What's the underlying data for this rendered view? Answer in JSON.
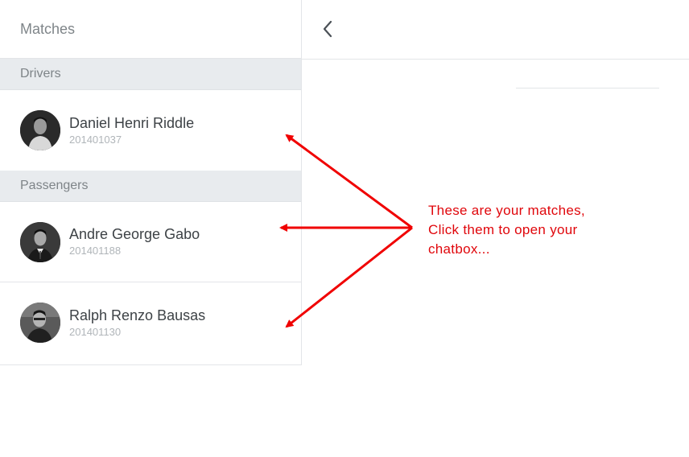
{
  "sidebar": {
    "title": "Matches",
    "sections": [
      {
        "label": "Drivers",
        "items": [
          {
            "name": "Daniel Henri Riddle",
            "id": "201401037"
          }
        ]
      },
      {
        "label": "Passengers",
        "items": [
          {
            "name": "Andre George Gabo",
            "id": "201401188"
          },
          {
            "name": "Ralph Renzo Bausas",
            "id": "201401130"
          }
        ]
      }
    ]
  },
  "chat": {
    "back_icon": "chevron-left-icon"
  },
  "annotation": {
    "line1": "These are your matches,",
    "line2": "Click them to open your",
    "line3": "chatbox...",
    "color": "#e0060b"
  }
}
